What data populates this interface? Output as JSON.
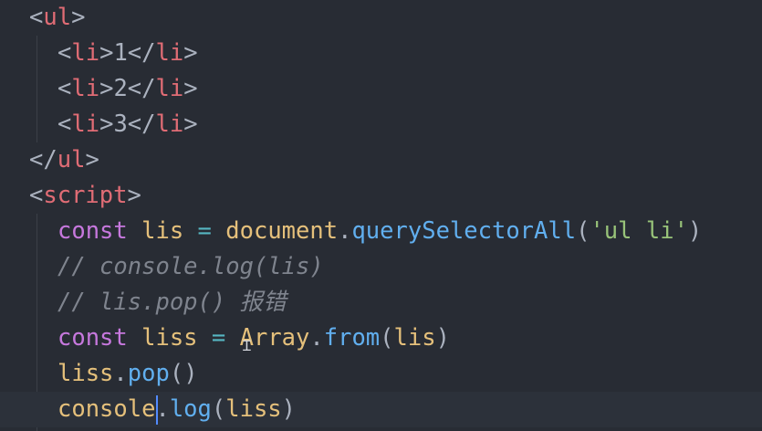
{
  "colors": {
    "background": "#282c34",
    "tag": "#e06c75",
    "keyword": "#c678dd",
    "variable": "#e5c07b",
    "function": "#61afef",
    "operator": "#56b6c2",
    "string": "#98c379",
    "comment": "#7f848e",
    "punctuation": "#abb2bf"
  },
  "code": {
    "l1": {
      "open": "<",
      "tag": "ul",
      "close": ">"
    },
    "l2": {
      "open": "<",
      "tag1": "li",
      "close1": ">",
      "text": "1",
      "open2": "</",
      "tag2": "li",
      "close2": ">"
    },
    "l3": {
      "open": "<",
      "tag1": "li",
      "close1": ">",
      "text": "2",
      "open2": "</",
      "tag2": "li",
      "close2": ">"
    },
    "l4": {
      "open": "<",
      "tag1": "li",
      "close1": ">",
      "text": "3",
      "open2": "</",
      "tag2": "li",
      "close2": ">"
    },
    "l5": {
      "open": "</",
      "tag": "ul",
      "close": ">"
    },
    "l6": {
      "open": "<",
      "tag": "script",
      "close": ">"
    },
    "l7": {
      "kw": "const",
      "var": "lis",
      "op": "=",
      "obj": "document",
      "dot": ".",
      "fn": "querySelectorAll",
      "paren_open": "(",
      "str": "'ul li'",
      "paren_close": ")"
    },
    "l8": {
      "comment": "// console.log(lis)"
    },
    "l9": {
      "comment": "// lis.pop() 报错"
    },
    "l10": {
      "kw": "const",
      "var": "liss",
      "op": "=",
      "obj": "Array",
      "dot": ".",
      "fn": "from",
      "paren_open": "(",
      "arg": "lis",
      "paren_close": ")"
    },
    "l11": {
      "obj": "liss",
      "dot": ".",
      "fn": "pop",
      "parens": "()"
    },
    "l12": {
      "obj": "console",
      "dot": ".",
      "fn": "log",
      "paren_open": "(",
      "arg": "liss",
      "paren_close": ")"
    }
  },
  "icons": {
    "text_cursor": "I",
    "mouse_ibeam": "Ɪ"
  }
}
